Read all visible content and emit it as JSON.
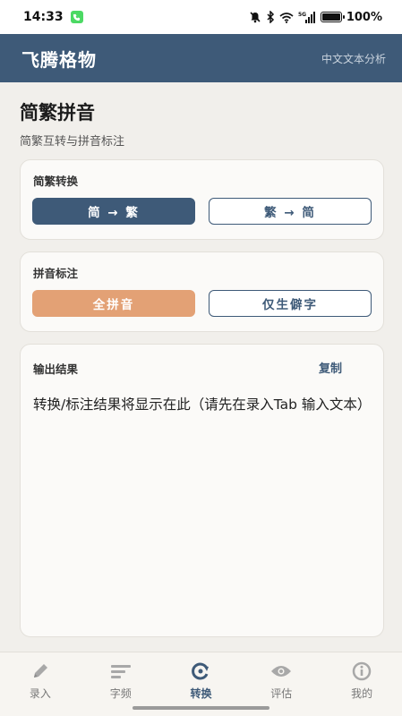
{
  "status_bar": {
    "time": "14:33",
    "battery": "100%",
    "network": "5G"
  },
  "header": {
    "title": "飞腾格物",
    "subtitle": "中文文本分析"
  },
  "page": {
    "title": "简繁拼音",
    "description": "简繁互转与拼音标注"
  },
  "conversion": {
    "label": "简繁转换",
    "to_traditional": "简 → 繁",
    "to_simplified": "繁 → 简"
  },
  "pinyin": {
    "label": "拼音标注",
    "full_pinyin": "全拼音",
    "rare_only": "仅生僻字"
  },
  "output": {
    "label": "输出结果",
    "copy": "复制",
    "placeholder": "转换/标注结果将显示在此（请先在录入Tab 输入文本）"
  },
  "nav": {
    "items": [
      {
        "label": "录入",
        "icon": "pencil-icon"
      },
      {
        "label": "字频",
        "icon": "bars-icon"
      },
      {
        "label": "转换",
        "icon": "convert-icon"
      },
      {
        "label": "评估",
        "icon": "eye-icon"
      },
      {
        "label": "我的",
        "icon": "info-icon"
      }
    ],
    "active": "转换"
  },
  "colors": {
    "primary": "#3e5a78",
    "accent": "#e3a175",
    "background": "#f1efeb"
  }
}
